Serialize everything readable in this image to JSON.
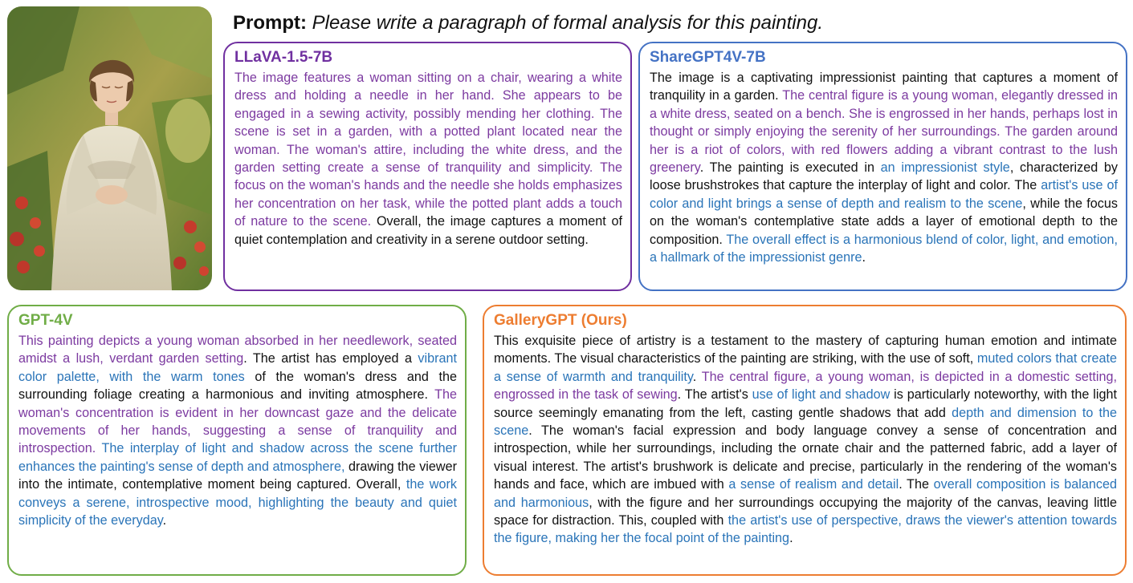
{
  "prompt": {
    "label": "Prompt:",
    "text": "Please write a paragraph of formal analysis for this painting."
  },
  "colors": {
    "llava": "#7030a0",
    "sharegpt": "#4472c4",
    "gpt4v": "#70ad47",
    "gallery": "#ed7d31",
    "highlight_purple": "#7c3aa0",
    "highlight_blue": "#2a74b8"
  },
  "panels": [
    {
      "title": "LLaVA-1.5-7B",
      "segments": [
        {
          "text": "The image features a woman sitting on a chair, wearing a white dress and holding a needle in her hand. She appears to be engaged in a sewing activity, possibly mending her clothing. The scene is set in a garden, with a potted plant located near the woman. The woman's attire, including the white dress, and the garden setting create a sense of tranquility and simplicity. The focus on the woman's hands and the needle she holds emphasizes her concentration on her task, while the potted plant adds a touch of nature to the scene.",
          "style": "purple"
        },
        {
          "text": " Overall, the image captures a moment of quiet contemplation and creativity in a serene outdoor setting.",
          "style": "plain"
        }
      ]
    },
    {
      "title": "ShareGPT4V-7B",
      "segments": [
        {
          "text": "The image is a captivating impressionist painting that captures a moment of tranquility in a garden. ",
          "style": "plain"
        },
        {
          "text": "The central figure is a young woman, elegantly dressed in a white dress, seated on a bench. She is engrossed in her hands, perhaps lost in thought or simply enjoying the serenity of her surroundings. The garden around her is a riot of colors, with red flowers adding a vibrant contrast to the lush greenery",
          "style": "purple"
        },
        {
          "text": ". The painting is executed in ",
          "style": "plain"
        },
        {
          "text": "an impressionist style",
          "style": "blue"
        },
        {
          "text": ", characterized by loose brushstrokes that capture the interplay of light and color. The ",
          "style": "plain"
        },
        {
          "text": "artist's use of color and light brings a sense of depth and realism to the scene",
          "style": "blue"
        },
        {
          "text": ", while the focus on the woman's contemplative state adds a layer of emotional depth to the composition. ",
          "style": "plain"
        },
        {
          "text": "The overall effect is a harmonious blend of color, light, and emotion, a hallmark of the impressionist genre",
          "style": "blue"
        },
        {
          "text": ".",
          "style": "plain"
        }
      ]
    },
    {
      "title": "GPT-4V",
      "segments": [
        {
          "text": "This painting depicts a young woman absorbed in her needlework, seated amidst a lush, verdant garden setting",
          "style": "purple"
        },
        {
          "text": ". The artist has employed a ",
          "style": "plain"
        },
        {
          "text": "vibrant color palette, with the warm tones",
          "style": "blue"
        },
        {
          "text": " of the woman's dress and the surrounding foliage creating a harmonious and inviting atmosphere. ",
          "style": "plain"
        },
        {
          "text": "The woman's concentration is evident in her downcast gaze and the delicate movements of her hands, suggesting a sense of tranquility and introspection.",
          "style": "purple"
        },
        {
          "text": " ",
          "style": "plain"
        },
        {
          "text": "The interplay of light and shadow across the scene further enhances the painting's sense of depth and atmosphere,",
          "style": "blue"
        },
        {
          "text": " drawing the viewer into the intimate, contemplative moment being captured. Overall, ",
          "style": "plain"
        },
        {
          "text": "the work conveys a serene, introspective mood, highlighting the beauty and quiet simplicity of the everyday",
          "style": "blue"
        },
        {
          "text": ".",
          "style": "plain"
        }
      ]
    },
    {
      "title": "GalleryGPT (Ours)",
      "segments": [
        {
          "text": "This exquisite piece of artistry is a testament to the mastery of capturing human emotion and intimate moments. The visual characteristics of the painting are striking, with the use of soft, ",
          "style": "plain"
        },
        {
          "text": "muted colors that create a sense of warmth and tranquility",
          "style": "blue"
        },
        {
          "text": ". ",
          "style": "plain"
        },
        {
          "text": "The central figure, a young woman, is depicted in a domestic setting, engrossed in the task of sewing",
          "style": "purple"
        },
        {
          "text": ". The artist's ",
          "style": "plain"
        },
        {
          "text": "use of light and shadow",
          "style": "blue"
        },
        {
          "text": " is particularly noteworthy, with the light source seemingly emanating from the left, casting gentle shadows that add ",
          "style": "plain"
        },
        {
          "text": "depth and dimension to the scene",
          "style": "blue"
        },
        {
          "text": ". The woman's facial expression and body language convey a sense of concentration and introspection, while her surroundings, including the ornate chair and the patterned fabric, add a layer of visual interest. The artist's brushwork is delicate and precise, particularly in the rendering of the woman's hands and face, which are imbued with ",
          "style": "plain"
        },
        {
          "text": "a sense of realism and detail",
          "style": "blue"
        },
        {
          "text": ". The ",
          "style": "plain"
        },
        {
          "text": "overall composition is balanced and harmonious",
          "style": "blue"
        },
        {
          "text": ", with the figure and her surroundings occupying the majority of the canvas, leaving little space for distraction. This, coupled with ",
          "style": "plain"
        },
        {
          "text": "the artist's use of perspective, draws the viewer's attention towards the figure, making her the focal point of the painting",
          "style": "blue"
        },
        {
          "text": ".",
          "style": "plain"
        }
      ]
    }
  ]
}
